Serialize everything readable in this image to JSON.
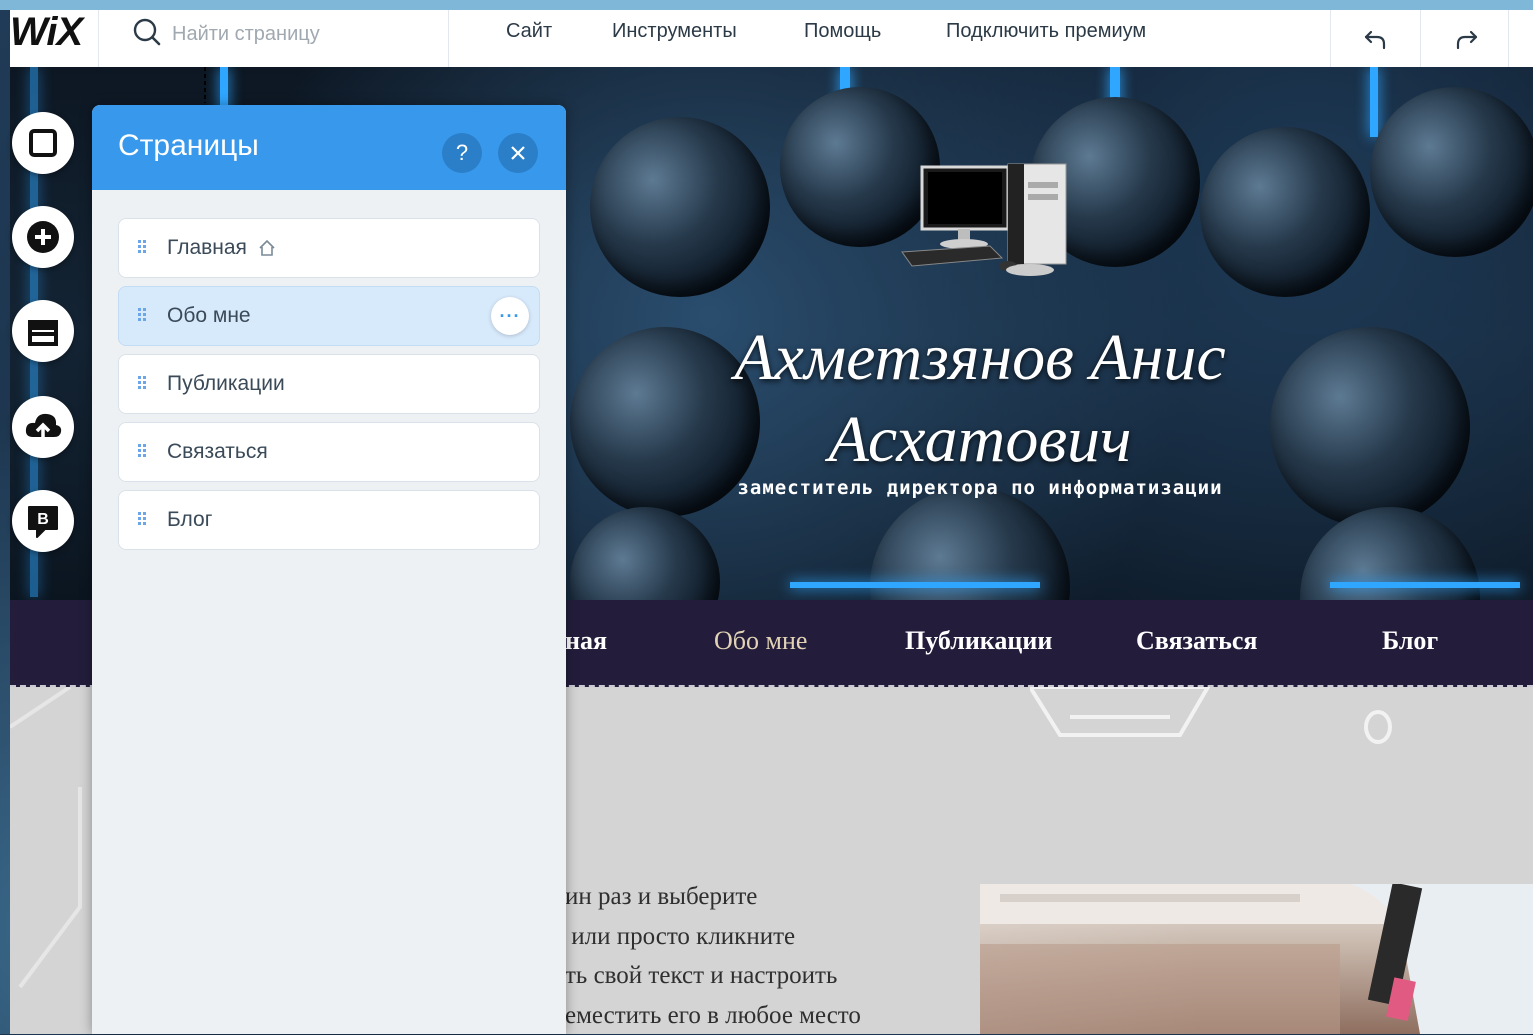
{
  "topbar": {
    "logo": "WiX",
    "search_placeholder": "Найти страницу",
    "menu": [
      "Сайт",
      "Инструменты",
      "Помощь",
      "Подключить премиум"
    ]
  },
  "left_toolbar": {
    "tools": [
      "page-icon",
      "add-icon",
      "store-icon",
      "upload-icon",
      "blog-icon"
    ],
    "blog_letter": "B"
  },
  "pages_panel": {
    "title": "Страницы",
    "help_label": "?",
    "close_label": "✕",
    "pages": [
      {
        "label": "Главная",
        "home": true,
        "selected": false
      },
      {
        "label": "Обо мне",
        "home": false,
        "selected": true
      },
      {
        "label": "Публикации",
        "home": false,
        "selected": false
      },
      {
        "label": "Связаться",
        "home": false,
        "selected": false
      },
      {
        "label": "Блог",
        "home": false,
        "selected": false
      }
    ],
    "more_label": "···"
  },
  "site": {
    "hero": {
      "title_line1": "Ахметзянов Анис",
      "title_line2": "Асхатович",
      "subtitle": "заместитель директора по информатизации"
    },
    "nav": [
      {
        "label": "ная",
        "active": false
      },
      {
        "label": "Обо мне",
        "active": true
      },
      {
        "label": "Публикации",
        "active": false
      },
      {
        "label": "Связаться",
        "active": false
      },
      {
        "label": "Блог",
        "active": false
      }
    ],
    "body_text": [
      "ин раз и выберите",
      " или просто кликните",
      "ть свой текст и настроить",
      "еместить его в любое место"
    ]
  },
  "colors": {
    "accent": "#3899ec",
    "navbar": "#231d3b",
    "active_nav": "#e2d3b6"
  }
}
